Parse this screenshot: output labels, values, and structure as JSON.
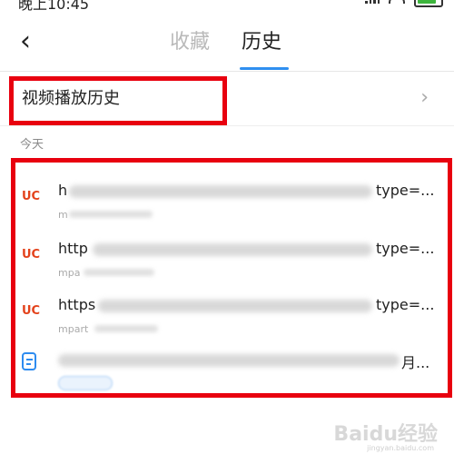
{
  "status": {
    "time": "晚上10:45"
  },
  "header": {
    "back_icon": "chevron-left-icon",
    "tabs": [
      {
        "label": "收藏",
        "active": false
      },
      {
        "label": "历史",
        "active": true
      }
    ],
    "accent": "#2f8ff0"
  },
  "video_history": {
    "label": "视频播放历史",
    "chevron": "›"
  },
  "section_label": "今天",
  "items": [
    {
      "icon": "uc-icon",
      "icon_text": "UC",
      "title_prefix": "h",
      "title_suffix": "type=...",
      "subtitle": "m"
    },
    {
      "icon": "uc-icon",
      "icon_text": "UC",
      "title_prefix": "http",
      "title_suffix": "type=...",
      "subtitle": "mpa"
    },
    {
      "icon": "uc-icon",
      "icon_text": "UC",
      "title_prefix": "https",
      "title_suffix": "type=...",
      "subtitle": "mpart"
    },
    {
      "icon": "document-icon",
      "title_prefix": "",
      "title_suffix": "月...",
      "subtitle": ""
    }
  ],
  "watermark": {
    "text": "Baidu经验",
    "sub": "jingyan.baidu.com"
  },
  "colors": {
    "annotation_red": "#e8000f",
    "uc_orange": "#e3421b",
    "doc_blue": "#2e8cf0"
  }
}
